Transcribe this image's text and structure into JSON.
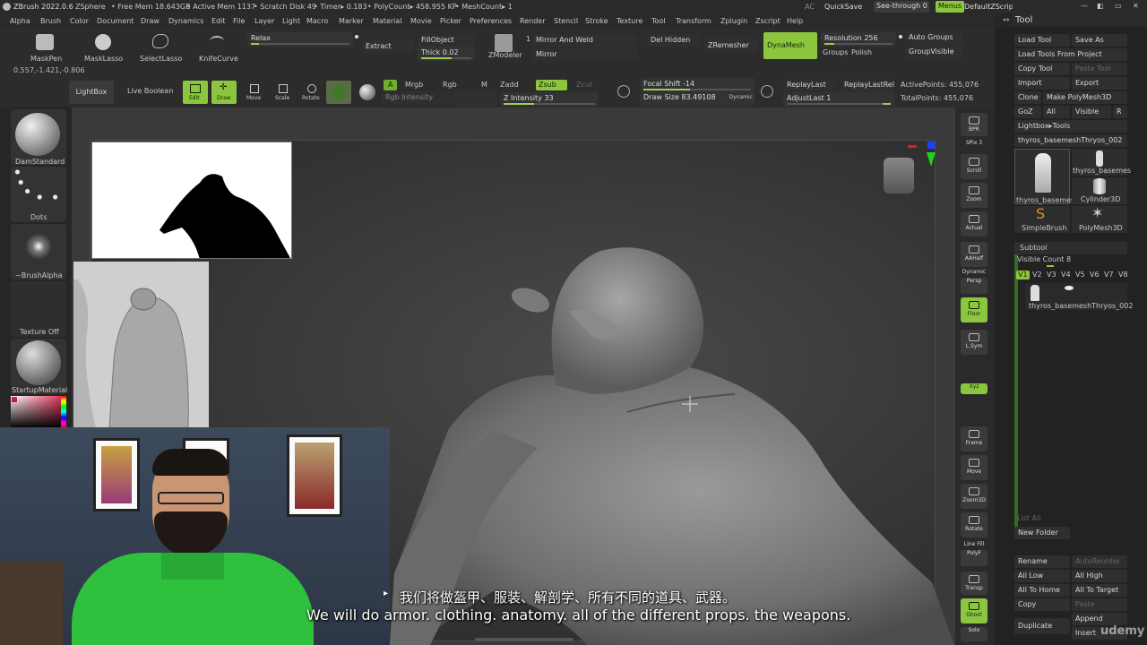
{
  "titlebar": {
    "app": "ZBrush 2022.0.6",
    "zsphere": "ZSphere",
    "free_mem": "• Free Mem 18.643GB",
    "active_mem": "• Active Mem 1137",
    "scratch": "• Scratch Disk 49",
    "timer": "• Timer▸ 0.183",
    "polycount": "• PolyCount▸ 458.955 KP",
    "meshcount": "• MeshCount▸ 1",
    "ac": "AC",
    "quicksave": "QuickSave",
    "see_through": "See-through  0",
    "menus": "Menus",
    "script": "DefaultZScript"
  },
  "menubar": [
    "Alpha",
    "Brush",
    "Color",
    "Document",
    "Draw",
    "Dynamics",
    "Edit",
    "File",
    "Layer",
    "Light",
    "Macro",
    "Marker",
    "Material",
    "Movie",
    "Picker",
    "Preferences",
    "Render",
    "Stencil",
    "Stroke",
    "Texture",
    "Tool",
    "Transform",
    "Zplugin",
    "Zscript",
    "Help"
  ],
  "topshelf": {
    "brushes": [
      "MaskPen",
      "MaskLasso",
      "SelectLasso",
      "KnifeCurve"
    ],
    "relax": "Relax",
    "extract": "Extract",
    "fill_object": "FillObject",
    "thick": "Thick 0.02",
    "zmodeler_num": "1",
    "zmodeler": "ZModeler",
    "mirror_and_weld": "Mirror And Weld",
    "mirror": "Mirror",
    "del_hidden": "Del Hidden",
    "zremesher": "ZRemesher",
    "dynamesh": "DynaMesh",
    "resolution": "Resolution 256",
    "groups": "Groups",
    "polish": "Polish",
    "auto_groups": "Auto Groups",
    "group_visible": "GroupVisible",
    "coords": "0.557,-1.421,-0.806"
  },
  "drawbar": {
    "lightbox": "LightBox",
    "live_boolean": "Live Boolean",
    "edit": "Edit",
    "draw": "Draw",
    "move": "Move",
    "scale": "Scale",
    "rotate": "Rotate",
    "a": "A",
    "mrgb": "Mrgb",
    "rgb": "Rgb",
    "m": "M",
    "rgb_intensity": "Rgb Intensity",
    "zadd": "Zadd",
    "zsub": "Zsub",
    "zcut": "Zcut",
    "z_intensity": "Z Intensity 33",
    "focal_shift": "Focal Shift -14",
    "draw_size": "Draw Size 83.49108",
    "dynamic": "Dynamic",
    "replay_last": "ReplayLast",
    "replay_last_rel": "ReplayLastRel",
    "adjust_last": "AdjustLast 1",
    "active_points": "ActivePoints: 455,076",
    "total_points": "TotalPoints: 455,076",
    "z_intensity_level": 0.33,
    "focal_shift_level": 0.43
  },
  "leftshelf": {
    "brush": "DamStandard",
    "stroke": "Dots",
    "alpha": "~BrushAlpha",
    "texture": "Texture Off",
    "material": "StartupMaterial"
  },
  "rightshelf": [
    "BPR",
    "SPix 3",
    "Scroll",
    "Zoom",
    "Actual",
    "AAHalf",
    "Dynamic",
    "Persp",
    "Floor",
    "L.Sym",
    "Xyz",
    "Frame",
    "Move",
    "Zoom3D",
    "Rotate",
    "Line Fill",
    "PolyF",
    "Transp",
    "Ghost",
    "Solo"
  ],
  "toolpanel": {
    "title": "Tool",
    "load_tool": "Load Tool",
    "save_as": "Save As",
    "load_from_project": "Load Tools From Project",
    "copy_tool": "Copy Tool",
    "paste_tool": "Paste Tool",
    "import": "Import",
    "export": "Export",
    "clone": "Clone",
    "make_polymesh": "Make PolyMesh3D",
    "goz": "GoZ",
    "all": "All",
    "visible": "Visible",
    "r": "R",
    "lightbox_tools": "Lightbox▸Tools",
    "current_tool": "thyros_basemeshThryos_002",
    "thumbs": [
      "thyros_basemes",
      "thyros_basemes",
      "Cylinder3D",
      "SimpleBrush",
      "PolyMesh3D"
    ],
    "subtool": "Subtool",
    "visible_count": "Visible Count 8",
    "versions": [
      "V1",
      "V2",
      "V3",
      "V4",
      "V5",
      "V6",
      "V7",
      "V8"
    ],
    "subtool_name": "thyros_basemeshThryos_002",
    "list_all": "List All",
    "new_folder": "New Folder",
    "rename": "Rename",
    "auto_reorder": "AutoReorder",
    "all_low": "All Low",
    "all_high": "All High",
    "all_to_home": "All To Home",
    "all_to_target": "All To Target",
    "copy": "Copy",
    "paste": "Paste",
    "duplicate": "Duplicate",
    "append": "Append",
    "insert": "Insert"
  },
  "subtitles": {
    "zh": "我们将做盔甲、服装、解剖学、所有不同的道具、武器。",
    "en": "We will do armor. clothing. anatomy. all of the different props. the weapons."
  },
  "watermark": "udemy"
}
